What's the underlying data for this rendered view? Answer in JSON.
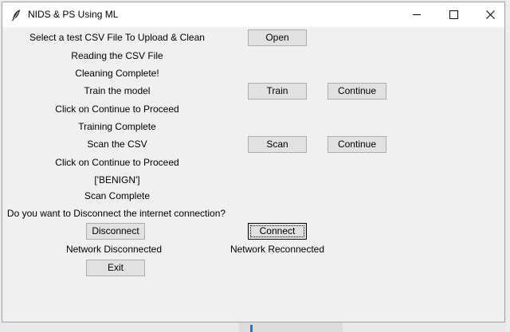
{
  "window": {
    "title": "NIDS & PS Using ML"
  },
  "labels": {
    "select_csv": "Select a test CSV File To Upload & Clean",
    "reading_csv": "Reading the CSV File",
    "cleaning_complete": "Cleaning Complete!",
    "train_model": "Train the model",
    "click_continue_1": "Click on Continue to Proceed",
    "training_complete": "Training Complete",
    "scan_csv": "Scan the CSV",
    "click_continue_2": "Click on Continue to Proceed",
    "scan_result": "['BENIGN']",
    "scan_complete": "Scan Complete",
    "disconnect_prompt": "Do you want to Disconnect the internet connection?",
    "network_disconnected": "Network Disconnected",
    "network_reconnected": "Network Reconnected"
  },
  "buttons": {
    "open": "Open",
    "train": "Train",
    "continue_train": "Continue",
    "scan": "Scan",
    "continue_scan": "Continue",
    "disconnect": "Disconnect",
    "connect": "Connect",
    "exit": "Exit"
  },
  "icons": {
    "app": "feather-icon",
    "minimize": "minimize-icon",
    "maximize": "maximize-icon",
    "close": "close-icon"
  }
}
